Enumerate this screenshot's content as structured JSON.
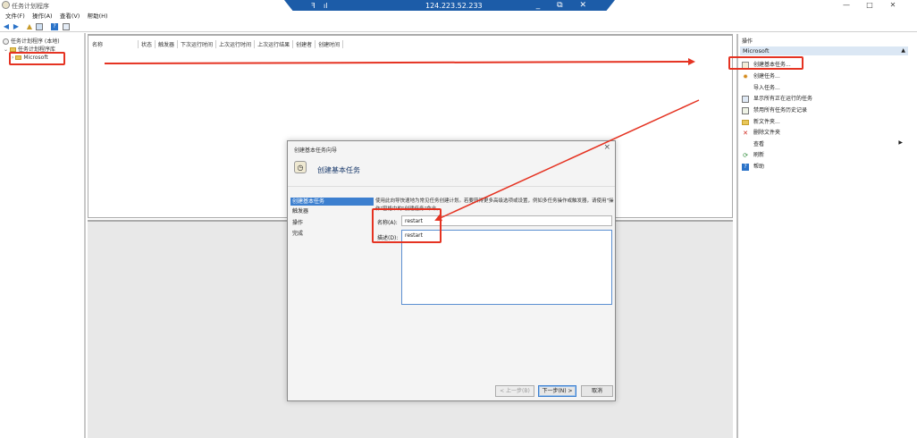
{
  "window": {
    "title": "任务计划程序",
    "controls": [
      "—",
      "□",
      "✕"
    ]
  },
  "remote_bar": {
    "pin": "ꟻ",
    "signal": "ıl",
    "ip": "124.223.52.233",
    "controls": "_ ⧉ ✕"
  },
  "menu": [
    "文件(F)",
    "操作(A)",
    "查看(V)",
    "帮助(H)"
  ],
  "tree": {
    "root": "任务计划程序 (本地)",
    "library": "任务计划程序库",
    "child": "Microsoft"
  },
  "task_list": {
    "columns": [
      "名称",
      "状态",
      "触发器",
      "下次运行时间",
      "上次运行时间",
      "上次运行结果",
      "创建者",
      "创建时间"
    ]
  },
  "actions": {
    "title": "操作",
    "section": "Microsoft",
    "items": [
      {
        "label": "创建基本任务...",
        "icon": "basic-task-icon"
      },
      {
        "label": "创建任务...",
        "icon": "task-icon"
      },
      {
        "label": "导入任务...",
        "icon": "import-icon"
      },
      {
        "label": "显示所有正在运行的任务",
        "icon": "running-icon"
      },
      {
        "label": "禁用所有任务历史记录",
        "icon": "history-icon"
      },
      {
        "label": "新文件夹...",
        "icon": "folder-icon"
      },
      {
        "label": "删除文件夹",
        "icon": "delete-icon"
      },
      {
        "label": "查看",
        "icon": "view-icon"
      },
      {
        "label": "刷新",
        "icon": "refresh-icon"
      },
      {
        "label": "帮助",
        "icon": "help-icon"
      }
    ]
  },
  "dialog": {
    "title": "创建基本任务向导",
    "header": "创建基本任务",
    "steps": [
      "创建基本任务",
      "触发器",
      "操作",
      "完成"
    ],
    "description": "使用此向导快速地为常见任务创建计划。若要获得更多高级选项或设置，例如多任务操作或触发器，请使用\"操作\"窗格中的\"创建任务\"命令。",
    "name_label": "名称(A):",
    "name_value": "restart",
    "desc_label": "描述(D):",
    "desc_value": "restart",
    "buttons": {
      "back": "< 上一步(B)",
      "next": "下一步(N) >",
      "cancel": "取消"
    }
  },
  "colors": {
    "annotation": "#e53322",
    "remote_bar": "#1c5ca8",
    "selected_step": "#3c7fcf"
  }
}
